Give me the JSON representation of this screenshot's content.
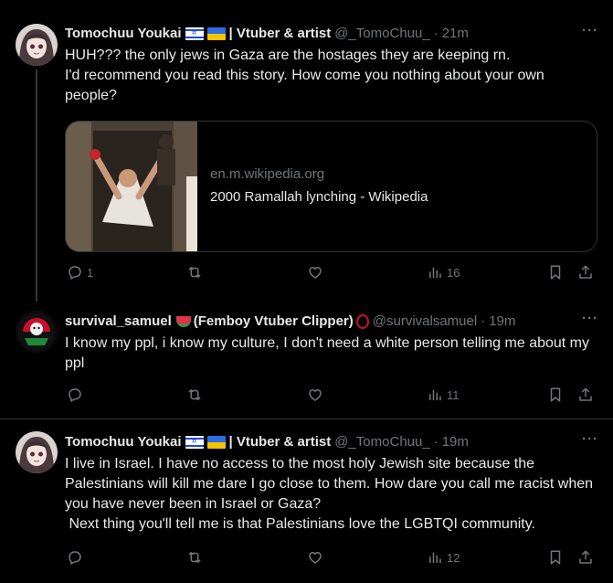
{
  "tweets": [
    {
      "name": "Tomochuu Youkai",
      "name_suffix": "| Vtuber & artist",
      "handle": "@_TomoChuu_",
      "time": "21m",
      "text": "HUH??? the only jews in Gaza are the hostages they are keeping rn.\nI'd recommend you read this story. How come you nothing about your own people?",
      "card": {
        "domain": "en.m.wikipedia.org",
        "title": "2000 Ramallah lynching - Wikipedia"
      },
      "stats": {
        "replies": "1",
        "retweets": "",
        "likes": "",
        "views": "16"
      }
    },
    {
      "name": "survival_samuel",
      "name_suffix": "(Femboy Vtuber Clipper)",
      "handle": "@survivalsamuel",
      "time": "19m",
      "text": "I know my ppl, i know my culture, I don't need a white person telling me about my ppl",
      "stats": {
        "replies": "",
        "retweets": "",
        "likes": "",
        "views": "11"
      }
    },
    {
      "name": "Tomochuu Youkai",
      "name_suffix": "| Vtuber & artist",
      "handle": "@_TomoChuu_",
      "time": "19m",
      "text": "I live in Israel. I have no access to the most holy Jewish site because the Palestinians will kill me dare I go close to them. How dare you call me racist when you have never been in Israel or Gaza?\n Next thing you'll tell me is that Palestinians love the LGBTQI community.",
      "stats": {
        "replies": "",
        "retweets": "",
        "likes": "",
        "views": "12"
      }
    }
  ],
  "dot": "·",
  "more_label": "···",
  "colors": {
    "background": "#000000",
    "text": "#e7e9ea",
    "muted": "#71767b",
    "border": "#2f3336"
  },
  "icons": [
    "reply-icon",
    "retweet-icon",
    "like-icon",
    "views-icon",
    "bookmark-icon",
    "share-icon",
    "more-icon"
  ]
}
